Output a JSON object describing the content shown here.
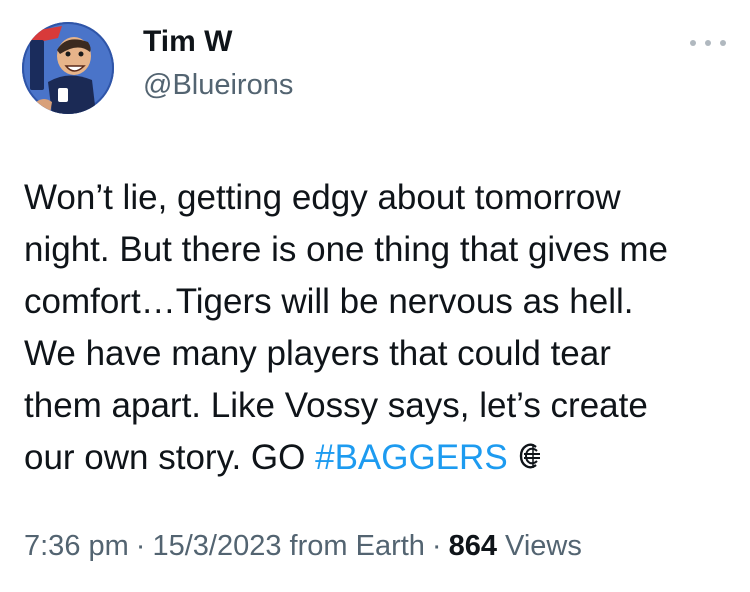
{
  "author": {
    "display_name": "Tim W",
    "handle": "@Blueirons",
    "avatar_icon": "cartoon-avatar"
  },
  "more_icon": "more-dots-icon",
  "tweet": {
    "lines": [
      "Won’t lie, getting edgy about tomorrow",
      "night. But there is one thing that gives me",
      "comfort…Tigers will be nervous as hell.",
      "We have many players that could tear",
      "them apart. Like Vossy says, let’s create"
    ],
    "last_line_prefix": "our own story. GO ",
    "hashtag": "#BAGGERS",
    "trailing_icon": "carlton-logo-icon"
  },
  "meta": {
    "time": "7:36 pm",
    "separator": "·",
    "date": "15/3/2023",
    "source": "from Earth",
    "views_count": "864",
    "views_label": "Views"
  },
  "colors": {
    "text": "#0f1419",
    "secondary": "#536471",
    "link": "#1d9bf0"
  }
}
